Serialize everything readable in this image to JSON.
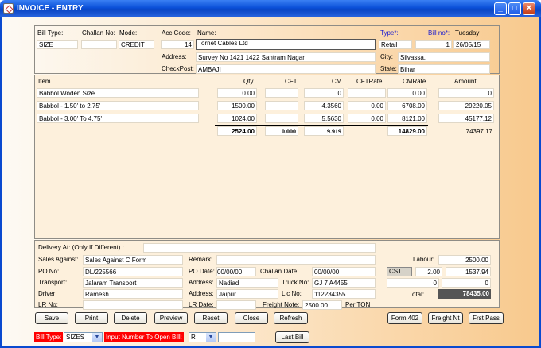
{
  "window": {
    "title": "INVOICE - ENTRY",
    "min": "_",
    "max": "□",
    "close": "✕",
    "icon": "invoice-app-icon"
  },
  "header": {
    "bill_type_label": "Bill Type:",
    "challan_no_label": "Challan No:",
    "mode_label": "Mode:",
    "bill_type": "SIZE",
    "challan_no": "",
    "mode": "CREDIT",
    "acc_code_label": "Acc Code:",
    "acc_code": "14",
    "name_label": "Name:",
    "name": "Tornet Cables Ltd",
    "address_label": "Address:",
    "address": "Survey No 1421 1422 Santram Nagar",
    "checkpost_label": "CheckPost:",
    "checkpost": "AMBAJI",
    "type_label": "Type*:",
    "type": "Retail",
    "bill_no_label": "Bill no*:",
    "bill_no": "1",
    "day": "Tuesday",
    "date": "26/05/15",
    "city_label": "City:",
    "city": "Silvassa.",
    "state_label": "State:",
    "state": "Bihar"
  },
  "items": {
    "columns": [
      "Item",
      "Qty",
      "CFT",
      "CM",
      "CFTRate",
      "CMRate",
      "Amount"
    ],
    "rows": [
      {
        "item": "Babbol Woden Size",
        "qty": "0.00",
        "cft": "",
        "cm": "0",
        "cftrate": "",
        "cmrate": "0.00",
        "amount": "0"
      },
      {
        "item": "Babbol - 1.50' to 2.75'",
        "qty": "1500.00",
        "cft": "",
        "cm": "4.3560",
        "cftrate": "0.00",
        "cmrate": "6708.00",
        "amount": "29220.05"
      },
      {
        "item": "Babbol - 3.00' To 4.75'",
        "qty": "1024.00",
        "cft": "",
        "cm": "5.5630",
        "cftrate": "0.00",
        "cmrate": "8121.00",
        "amount": "45177.12"
      }
    ],
    "totals": {
      "qty": "2524.00",
      "cft": "0.000",
      "cm": "9.919",
      "cmrate": "14829.00",
      "amount": "74397.17"
    }
  },
  "footer": {
    "delivery_label": "Delivery At: (Only If Different) :",
    "delivery": "",
    "sales_against_label": "Sales Against:",
    "sales_against": "Sales Against C Form",
    "remark_label": "Remark:",
    "remark": "",
    "po_no_label": "PO No:",
    "po_no": "DL/225566",
    "po_date_label": "PO Date:",
    "po_date": "00/00/00",
    "challan_date_label": "Challan Date:",
    "challan_date": "00/00/00",
    "transport_label": "Transport:",
    "transport": "Jalaram Transport",
    "address1_label": "Address:",
    "address1": "Nadiad",
    "truck_no_label": "Truck No:",
    "truck_no": "GJ 7 A4455",
    "driver_label": "Driver:",
    "driver": "Ramesh",
    "address2_label": "Address:",
    "address2": "Jaipur",
    "lic_no_label": "Lic No:",
    "lic_no": "112234355",
    "lr_no_label": "LR No:",
    "lr_no": "",
    "lr_date_label": "LR Date:",
    "lr_date": "",
    "freight_note_label": "Freight Note:",
    "freight_note": "2500.00",
    "freight_unit": "Per TON",
    "labour_label": "Labour:",
    "labour": "2500.00",
    "cst_label": "CST",
    "cst_rate": "2.00",
    "cst_amount": "1537.94",
    "extra1": "0",
    "extra2": "0",
    "total_label": "Total:",
    "total": "78435.00"
  },
  "buttons": {
    "save": "Save",
    "print": "Print",
    "delete": "Delete",
    "preview": "Preview",
    "reset": "Reset",
    "close": "Close",
    "refresh": "Refresh",
    "form402": "Form 402",
    "freight_nt": "Freight Nt",
    "frst_pass": "Frst Pass"
  },
  "bottom": {
    "bill_type_label": "Bill Type:",
    "bill_type_value": "SIZES",
    "open_bill_label": "Input Number To Open Bill:",
    "open_bill_prefix": "R",
    "open_bill_number": "",
    "last_bill": "Last Bill"
  },
  "colors": {
    "title_bar": "#0a4fd8",
    "accent_red": "#ff0000",
    "total_box": "#555555",
    "label_blue": "#1a1ad0"
  }
}
